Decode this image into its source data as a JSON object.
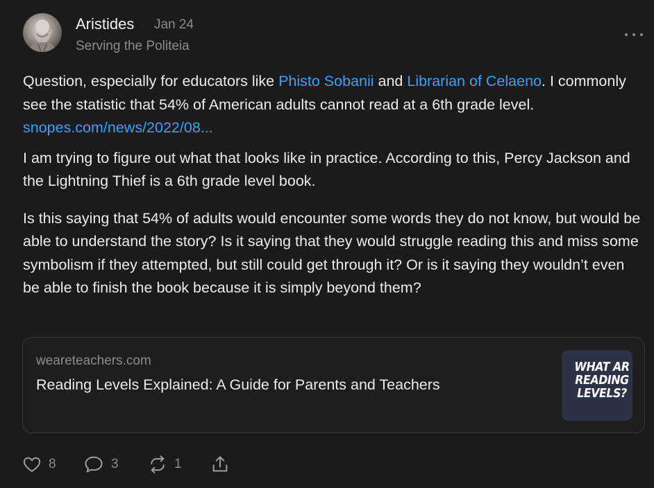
{
  "post": {
    "author": "Aristides",
    "date": "Jan 24",
    "bio": "Serving the Politeia",
    "paragraph1": {
      "before": "Question, especially for educators like ",
      "mention1": "Phisto Sobanii",
      "middle": " and ",
      "mention2": "Librarian of Celaeno",
      "after": ". I commonly see the statistic that 54% of American adults cannot read at a 6th grade level. ",
      "link": "snopes.com/news/2022/08..."
    },
    "paragraph2": "I am trying to figure out what that looks like in practice. According to this, Percy Jackson and the Lightning Thief is a 6th grade level book.",
    "paragraph3": "Is this saying that 54% of adults would encounter some words they do not know, but would be able to understand the story? Is it saying that they would struggle reading this and miss some symbolism if they attempted, but still could get through it? Or is it saying they wouldn’t even be able to finish the book because it is simply beyond them?"
  },
  "link_card": {
    "domain": "weareteachers.com",
    "title": "Reading Levels Explained: A Guide for Parents and Teachers",
    "thumb_text": "WHAT AR\nREADING\nLEVELS?"
  },
  "actions": {
    "likes": "8",
    "comments": "3",
    "restacks": "1"
  },
  "icons": {
    "like": "heart-icon",
    "comment": "comment-bubble-icon",
    "restack": "restack-icon",
    "share": "share-icon",
    "more": "more-horizontal-icon"
  },
  "colors": {
    "background": "#1b1b1d",
    "text": "#ececec",
    "muted": "#8c8c8e",
    "link": "#3ea1f6",
    "card_border": "#3a3a3d",
    "thumb_bg": "#2c3346"
  }
}
